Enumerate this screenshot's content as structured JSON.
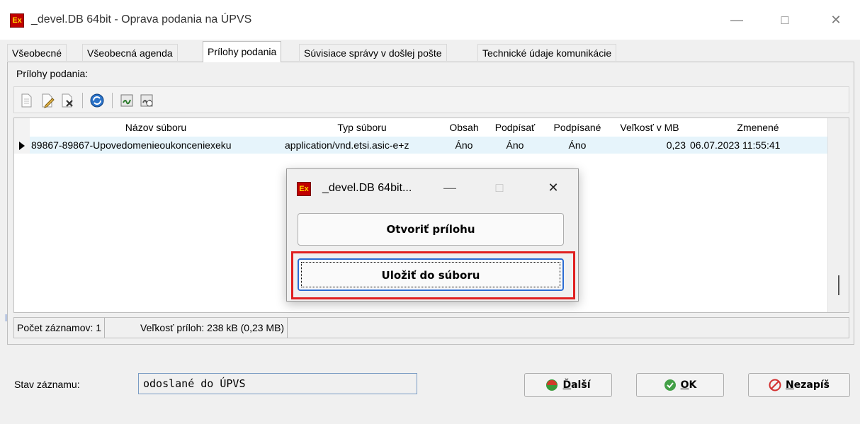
{
  "window": {
    "title": "_devel.DB 64bit - Oprava podania na ÚPVS",
    "icon_text": "Ex",
    "controls": [
      "minimize-icon",
      "maximize-icon",
      "close-icon"
    ]
  },
  "tabs": [
    {
      "label": "Všeobecné",
      "active": false
    },
    {
      "label": "Všeobecná agenda",
      "active": false
    },
    {
      "label": "Prílohy podania",
      "active": true
    },
    {
      "label": "Súvisiace správy v došlej pošte",
      "active": false
    },
    {
      "label": "Technické údaje komunikácie",
      "active": false
    }
  ],
  "group": {
    "label": "Prílohy podania:"
  },
  "toolbar": {
    "tools": [
      "new-document-icon",
      "edit-document-icon",
      "delete-document-icon",
      "refresh-icon",
      "sign-icon",
      "verify-signature-icon"
    ]
  },
  "grid": {
    "columns": [
      "Názov súboru",
      "Typ súboru",
      "Obsah",
      "Podpísať",
      "Podpísané",
      "Veľkosť v MB",
      "Zmenené"
    ],
    "rows": [
      [
        "89867-89867-Upovedomenieoukonceniexeku",
        "application/vnd.etsi.asic-e+z",
        "Áno",
        "Áno",
        "Áno",
        "0,23",
        "06.07.2023 11:55:41"
      ]
    ]
  },
  "statusbar": {
    "count": "Počet záznamov: 1",
    "size": "Veľkosť príloh: 238 kB (0,23 MB)"
  },
  "record_state": {
    "label": "Stav záznamu:",
    "value": "odoslané do ÚPVS"
  },
  "buttons": {
    "next_prefix": "Ď",
    "next_rest": "alší",
    "ok_prefix": "O",
    "ok_rest": "K",
    "cancel_prefix": "N",
    "cancel_rest": "ezapíš"
  },
  "dialog": {
    "title": "_devel.DB 64bit...",
    "open_label": "Otvoriť prílohu",
    "save_label": "Uložiť do súboru"
  },
  "colors": {
    "row_highlight": "#e6f4fb",
    "annotation_border": "#e02020",
    "focus_border": "#2b6cd3"
  }
}
